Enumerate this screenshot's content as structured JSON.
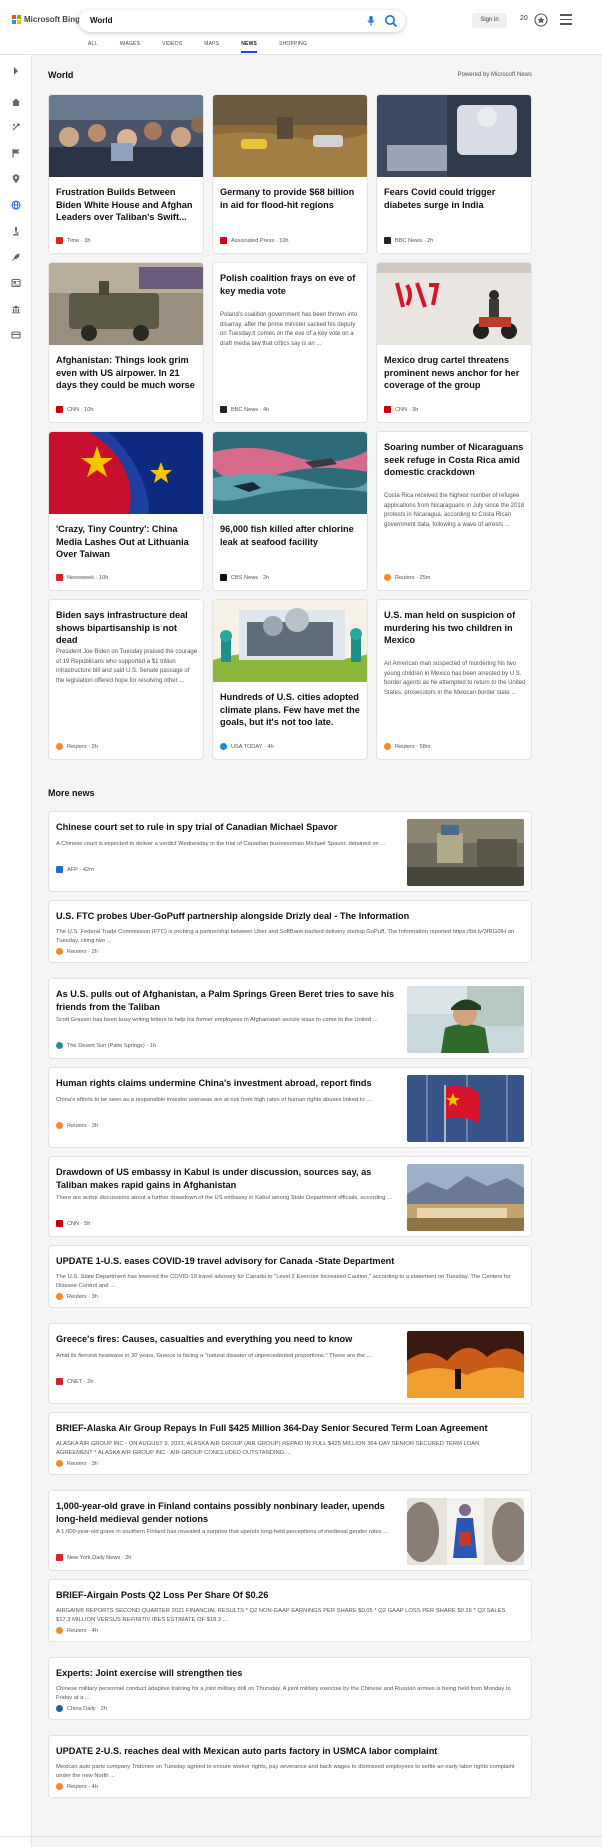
{
  "brand": {
    "name": "Microsoft Bing",
    "colors": [
      "#f25022",
      "#7fba00",
      "#00a4ef",
      "#ffb900"
    ]
  },
  "search": {
    "query": "World",
    "mic_icon": "microphone-icon",
    "search_icon": "search-icon"
  },
  "account": {
    "signin_label": "Sign in",
    "points": "20",
    "rewards_icon": "rewards-medal-icon",
    "menu_icon": "hamburger-menu-icon"
  },
  "scopes": [
    "ALL",
    "IMAGES",
    "VIDEOS",
    "MAPS",
    "NEWS",
    "SHOPPING"
  ],
  "active_scope": "NEWS",
  "rail_icons": [
    "chevron-right-icon",
    "home-icon",
    "discover-icon",
    "flag-icon",
    "location-pin-icon",
    "globe-icon",
    "microscope-icon",
    "rocket-icon",
    "news-icon",
    "building-icon",
    "card-icon"
  ],
  "section": {
    "title": "World",
    "powered_by": "Powered by Microsoft News"
  },
  "cards": [
    {
      "title": "Frustration Builds Between Biden White House and Afghan Leaders over Taliban's Swift...",
      "source": "Time",
      "age": "3h",
      "source_color": "#e31f26"
    },
    {
      "title": "Germany to provide $68 billion in aid for flood-hit regions",
      "source": "Associated Press",
      "age": "10h",
      "source_color": "#d0021b"
    },
    {
      "title": "Fears Covid could trigger diabetes surge in India",
      "source": "BBC News",
      "age": "2h",
      "source_color": "#222222"
    },
    {
      "title": "Afghanistan: Things look grim even with US airpower. In 21 days they could be much worse",
      "source": "CNN",
      "age": "10h",
      "source_color": "#cc0000"
    },
    {
      "title": "Polish coalition frays on eve of key media vote",
      "snippet": "Poland's coalition government has been thrown into disarray, after the prime minister sacked his deputy on Tuesday.It comes on the eve of a key vote on a draft media law that critics say is an ...",
      "source": "BBC News",
      "age": "4h",
      "source_color": "#222222"
    },
    {
      "title": "Mexico drug cartel threatens prominent news anchor for her coverage of the group",
      "source": "CNN",
      "age": "3h",
      "source_color": "#cc0000"
    },
    {
      "title": "'Crazy, Tiny Country': China Media Lashes Out at Lithuania Over Taiwan",
      "source": "Newsweek",
      "age": "10h",
      "source_color": "#e31f26"
    },
    {
      "title": "96,000 fish killed after chlorine leak at seafood facility",
      "source": "CBS News",
      "age": "2h",
      "source_color": "#111111"
    },
    {
      "title": "Soaring number of Nicaraguans seek refuge in Costa Rica amid domestic crackdown",
      "snippet": "Costa Rica received the highest number of refugee applications from Nicaraguans in July since the 2018 protests in Nicaragua, according to Costa Rican government data, following a wave of arrests ...",
      "source": "Reuters",
      "age": "25m",
      "source_color": "#f08a2b"
    },
    {
      "title": "Biden says infrastructure deal shows bipartisanship is not dead",
      "snippet": "President Joe Biden on Tuesday praised the courage of 19 Republicans who supported a $1 trillion infrastructure bill and said U.S. Senate passage of the legislation offered hope for resolving other ...",
      "source": "Reuters",
      "age": "2h",
      "source_color": "#f08a2b"
    },
    {
      "title": "Hundreds of U.S. cities adopted climate plans. Few have met the goals, but it's not too late.",
      "source": "USA TODAY",
      "age": "4h",
      "source_color": "#1a8ad4"
    },
    {
      "title": "U.S. man held on suspicion of murdering his two children in Mexico",
      "snippet": "An American man suspected of murdering his two young children in Mexico has been arrested by U.S. border agents as he attempted to return to the United States, prosecutors in the Mexican border state ...",
      "source": "Reuters",
      "age": "58m",
      "source_color": "#f08a2b"
    }
  ],
  "more_news": {
    "title": "More news",
    "items": [
      {
        "title": "Chinese court set to rule in spy trial of Canadian Michael Spavor",
        "snippet": "A Chinese court is expected to deliver a verdict Wednesday in the trial of Canadian businessman Michael Spavor, detained on ...",
        "source": "AFP",
        "age": "42m",
        "source_color": "#1a6fd1"
      },
      {
        "title": "U.S. FTC probes Uber-GoPuff partnership alongside Drizly deal - The Information",
        "snippet": "The U.S. Federal Trade Commission (FTC) is probing a partnership between Uber and SoftBank-backed delivery startup GoPuff, The Information reported https://bit.ly/3fRG0IH on Tuesday, citing two ...",
        "source": "Reuters",
        "age": "2h",
        "source_color": "#f08a2b"
      },
      {
        "title": "As U.S. pulls out of Afghanistan, a Palm Springs Green Beret tries to save his friends from the Taliban",
        "snippet": "Scott Grasser has been busy writing letters to help his former employees in Afghanistan secure visas to come to the United ...",
        "source": "The Desert Sun (Palm Springs)",
        "age": "1h",
        "source_color": "#2f8a9e"
      },
      {
        "title": "Human rights claims undermine China's investment abroad, report finds",
        "snippet": "China's efforts to be seen as a responsible investor overseas are at risk from high rates of human rights abuses linked to ...",
        "source": "Reuters",
        "age": "3h",
        "source_color": "#f08a2b"
      },
      {
        "title": "Drawdown of US embassy in Kabul is under discussion, sources say, as Taliban makes rapid gains in Afghanistan",
        "snippet": "There are active discussions about a further drawdown of the US embassy in Kabul among State Department officials, according ...",
        "source": "CNN",
        "age": "5h",
        "source_color": "#cc0000"
      },
      {
        "title": "UPDATE 1-U.S. eases COVID-19 travel advisory for Canada -State Department",
        "snippet": "The U.S. State Department has lowered the COVID-19 travel advisory for Canada to \"Level 2 Exercise Increased Caution,\" according to a statement on Tuesday. The Centers for Disease Control and ...",
        "source": "Reuters",
        "age": "3h",
        "source_color": "#f08a2b"
      },
      {
        "title": "Greece's fires: Causes, casualties and everything you need to know",
        "snippet": "Amid its fiercest heatwave in 30 years, Greece is facing a \"natural disaster of unprecedented proportions.\" Those are the ...",
        "source": "CNET",
        "age": "2h",
        "source_color": "#d61f26"
      },
      {
        "title": "BRIEF-Alaska Air Group Repays In Full $425 Million 364-Day Senior Secured Term Loan Agreement",
        "snippet": "ALASKA AIR GROUP INC - ON AUGUST 9, 2021, ALASKA AIR GROUP (AIR GROUP) REPAID IN FULL $425 MILLION 364-DAY SENIOR SECURED TERM LOAN AGREEMENT * ALASKA AIR GROUP INC - AIR GROUP CONCLUDED OUTSTANDING ...",
        "source": "Reuters",
        "age": "3h",
        "source_color": "#f08a2b"
      },
      {
        "title": "1,000-year-old grave in Finland contains possibly nonbinary leader, upends long-held medieval gender notions",
        "snippet": "A 1,000-year-old grave in southern Finland has revealed a surprise that upends long-held perceptions of medieval gender roles ...",
        "source": "New York Daily News",
        "age": "2h",
        "source_color": "#e31f26"
      },
      {
        "title": "BRIEF-Airgain Posts Q2 Loss Per Share Of $0.26",
        "snippet": "AIRGAIN® REPORTS SECOND QUARTER 2021 FINANCIAL RESULTS * Q2 NON-GAAP EARNINGS PER SHARE $0.05 * Q2 GAAP LOSS PER SHARE $0.26 * Q2 SALES $17.3 MILLION VERSUS REFINITIV IBES ESTIMATE OF $18.3 ...",
        "source": "Reuters",
        "age": "4h",
        "source_color": "#f08a2b"
      },
      {
        "title": "Experts: Joint exercise will strengthen ties",
        "snippet": "Chinese military personnel conduct adaptive training for a joint military drill on Thursday. A joint military exercise by the Chinese and Russian armies is being held from Monday to Friday at a ...",
        "source": "China Daily",
        "age": "2h",
        "source_color": "#1a5fb4"
      },
      {
        "title": "UPDATE 2-U.S. reaches deal with Mexican auto parts factory in USMCA labor complaint",
        "snippet": "Mexican auto parts company Tridonex on Tuesday agreed to ensure worker rights, pay severance and back wages to dismissed employees to settle an early labor rights complaint under the new North ...",
        "source": "Reuters",
        "age": "4h",
        "source_color": "#f08a2b"
      }
    ]
  }
}
